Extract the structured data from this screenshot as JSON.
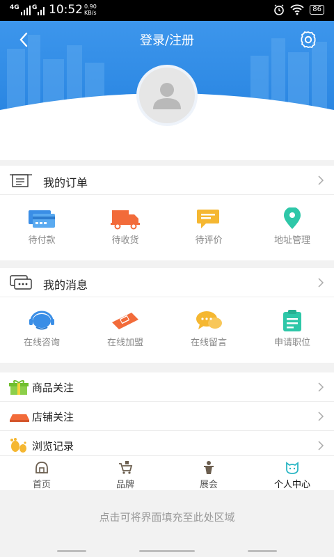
{
  "status_bar": {
    "sig1": "4G",
    "sig2": "G",
    "time": "10:52",
    "speed_value": "0.90",
    "speed_unit": "KB/s",
    "battery": "86"
  },
  "header": {
    "title": "登录/注册"
  },
  "orders": {
    "title": "我的订单",
    "items": [
      {
        "label": "待付款",
        "icon": "card-icon",
        "color": "#3a8ee6"
      },
      {
        "label": "待收货",
        "icon": "truck-icon",
        "color": "#f26b3a"
      },
      {
        "label": "待评价",
        "icon": "comment-icon",
        "color": "#f5b731"
      },
      {
        "label": "地址管理",
        "icon": "location-pin-icon",
        "color": "#2ec7a8"
      }
    ]
  },
  "messages": {
    "title": "我的消息",
    "items": [
      {
        "label": "在线咨询",
        "icon": "headset-icon",
        "color": "#3a8ee6"
      },
      {
        "label": "在线加盟",
        "icon": "franchise-icon",
        "color": "#f26b3a"
      },
      {
        "label": "在线留言",
        "icon": "chat-bubbles-icon",
        "color": "#f5b731"
      },
      {
        "label": "申请职位",
        "icon": "clipboard-icon",
        "color": "#2ec7a8"
      }
    ]
  },
  "list": [
    {
      "label": "商品关注",
      "icon": "gift-icon"
    },
    {
      "label": "店铺关注",
      "icon": "shop-icon"
    },
    {
      "label": "浏览记录",
      "icon": "footprint-icon"
    }
  ],
  "tabs": [
    {
      "label": "首页",
      "icon": "home-icon"
    },
    {
      "label": "品牌",
      "icon": "brand-icon"
    },
    {
      "label": "展会",
      "icon": "exhibition-icon"
    },
    {
      "label": "个人中心",
      "icon": "profile-icon",
      "active": true
    }
  ],
  "fill_hint": "点击可将界面填充至此处区域",
  "colors": {
    "header_blue": "#2f8be6",
    "active_tab": "#2ab6c4"
  }
}
